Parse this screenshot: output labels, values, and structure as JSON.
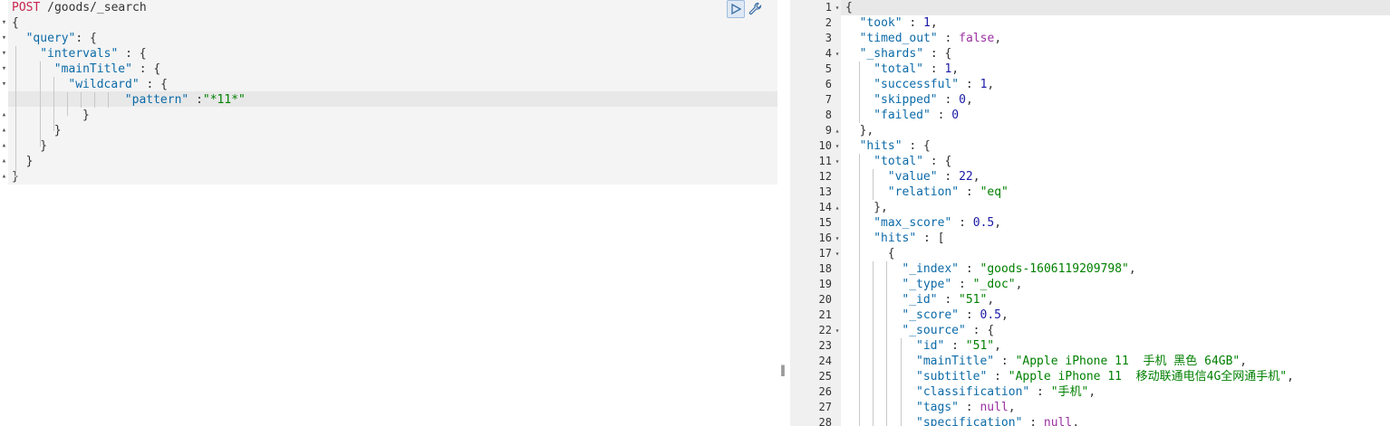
{
  "request": {
    "method": "POST",
    "path": "/goods/_search",
    "lines": [
      [
        {
          "t": "{",
          "c": "p"
        }
      ],
      [
        {
          "t": "\"query\"",
          "c": "k"
        },
        {
          "t": ": {",
          "c": "p"
        }
      ],
      [
        {
          "t": "\"intervals\"",
          "c": "k"
        },
        {
          "t": " : {",
          "c": "p"
        }
      ],
      [
        {
          "t": "\"mainTitle\"",
          "c": "k"
        },
        {
          "t": " : {",
          "c": "p"
        }
      ],
      [
        {
          "t": "\"wildcard\"",
          "c": "k"
        },
        {
          "t": " : {",
          "c": "p"
        }
      ],
      [
        {
          "t": "\"pattern\"",
          "c": "k"
        },
        {
          "t": " :",
          "c": "p"
        },
        {
          "t": "\"*11*\"",
          "c": "s"
        }
      ],
      [
        {
          "t": "}",
          "c": "p"
        }
      ],
      [
        {
          "t": "}",
          "c": "p"
        }
      ],
      [
        {
          "t": "}",
          "c": "p"
        }
      ],
      [
        {
          "t": "}",
          "c": "p"
        }
      ],
      [
        {
          "t": "}",
          "c": "p"
        }
      ]
    ]
  },
  "toolbar": {
    "run_icon": "play-icon",
    "settings_icon": "wrench-icon"
  },
  "response": {
    "line_numbers": [
      "1",
      "2",
      "3",
      "4",
      "5",
      "6",
      "7",
      "8",
      "9",
      "10",
      "11",
      "12",
      "13",
      "14",
      "15",
      "16",
      "17",
      "18",
      "19",
      "20",
      "21",
      "22",
      "23",
      "24",
      "25",
      "26",
      "27",
      "28"
    ],
    "lines": [
      [
        {
          "t": "{",
          "c": "p"
        }
      ],
      [
        {
          "t": "\"took\"",
          "c": "k"
        },
        {
          "t": " : ",
          "c": "p"
        },
        {
          "t": "1",
          "c": "n"
        },
        {
          "t": ",",
          "c": "p"
        }
      ],
      [
        {
          "t": "\"timed_out\"",
          "c": "k"
        },
        {
          "t": " : ",
          "c": "p"
        },
        {
          "t": "false",
          "c": "b"
        },
        {
          "t": ",",
          "c": "p"
        }
      ],
      [
        {
          "t": "\"_shards\"",
          "c": "k"
        },
        {
          "t": " : {",
          "c": "p"
        }
      ],
      [
        {
          "t": "\"total\"",
          "c": "k"
        },
        {
          "t": " : ",
          "c": "p"
        },
        {
          "t": "1",
          "c": "n"
        },
        {
          "t": ",",
          "c": "p"
        }
      ],
      [
        {
          "t": "\"successful\"",
          "c": "k"
        },
        {
          "t": " : ",
          "c": "p"
        },
        {
          "t": "1",
          "c": "n"
        },
        {
          "t": ",",
          "c": "p"
        }
      ],
      [
        {
          "t": "\"skipped\"",
          "c": "k"
        },
        {
          "t": " : ",
          "c": "p"
        },
        {
          "t": "0",
          "c": "n"
        },
        {
          "t": ",",
          "c": "p"
        }
      ],
      [
        {
          "t": "\"failed\"",
          "c": "k"
        },
        {
          "t": " : ",
          "c": "p"
        },
        {
          "t": "0",
          "c": "n"
        }
      ],
      [
        {
          "t": "},",
          "c": "p"
        }
      ],
      [
        {
          "t": "\"hits\"",
          "c": "k"
        },
        {
          "t": " : {",
          "c": "p"
        }
      ],
      [
        {
          "t": "\"total\"",
          "c": "k"
        },
        {
          "t": " : {",
          "c": "p"
        }
      ],
      [
        {
          "t": "\"value\"",
          "c": "k"
        },
        {
          "t": " : ",
          "c": "p"
        },
        {
          "t": "22",
          "c": "n"
        },
        {
          "t": ",",
          "c": "p"
        }
      ],
      [
        {
          "t": "\"relation\"",
          "c": "k"
        },
        {
          "t": " : ",
          "c": "p"
        },
        {
          "t": "\"eq\"",
          "c": "s"
        }
      ],
      [
        {
          "t": "},",
          "c": "p"
        }
      ],
      [
        {
          "t": "\"max_score\"",
          "c": "k"
        },
        {
          "t": " : ",
          "c": "p"
        },
        {
          "t": "0.5",
          "c": "n"
        },
        {
          "t": ",",
          "c": "p"
        }
      ],
      [
        {
          "t": "\"hits\"",
          "c": "k"
        },
        {
          "t": " : [",
          "c": "p"
        }
      ],
      [
        {
          "t": "{",
          "c": "p"
        }
      ],
      [
        {
          "t": "\"_index\"",
          "c": "k"
        },
        {
          "t": " : ",
          "c": "p"
        },
        {
          "t": "\"goods-1606119209798\"",
          "c": "s"
        },
        {
          "t": ",",
          "c": "p"
        }
      ],
      [
        {
          "t": "\"_type\"",
          "c": "k"
        },
        {
          "t": " : ",
          "c": "p"
        },
        {
          "t": "\"_doc\"",
          "c": "s"
        },
        {
          "t": ",",
          "c": "p"
        }
      ],
      [
        {
          "t": "\"_id\"",
          "c": "k"
        },
        {
          "t": " : ",
          "c": "p"
        },
        {
          "t": "\"51\"",
          "c": "s"
        },
        {
          "t": ",",
          "c": "p"
        }
      ],
      [
        {
          "t": "\"_score\"",
          "c": "k"
        },
        {
          "t": " : ",
          "c": "p"
        },
        {
          "t": "0.5",
          "c": "n"
        },
        {
          "t": ",",
          "c": "p"
        }
      ],
      [
        {
          "t": "\"_source\"",
          "c": "k"
        },
        {
          "t": " : {",
          "c": "p"
        }
      ],
      [
        {
          "t": "\"id\"",
          "c": "k"
        },
        {
          "t": " : ",
          "c": "p"
        },
        {
          "t": "\"51\"",
          "c": "s"
        },
        {
          "t": ",",
          "c": "p"
        }
      ],
      [
        {
          "t": "\"mainTitle\"",
          "c": "k"
        },
        {
          "t": " : ",
          "c": "p"
        },
        {
          "t": "\"Apple iPhone 11  手机 黑色 64GB\"",
          "c": "s"
        },
        {
          "t": ",",
          "c": "p"
        }
      ],
      [
        {
          "t": "\"subtitle\"",
          "c": "k"
        },
        {
          "t": " : ",
          "c": "p"
        },
        {
          "t": "\"Apple iPhone 11  移动联通电信4G全网通手机\"",
          "c": "s"
        },
        {
          "t": ",",
          "c": "p"
        }
      ],
      [
        {
          "t": "\"classification\"",
          "c": "k"
        },
        {
          "t": " : ",
          "c": "p"
        },
        {
          "t": "\"手机\"",
          "c": "s"
        },
        {
          "t": ",",
          "c": "p"
        }
      ],
      [
        {
          "t": "\"tags\"",
          "c": "k"
        },
        {
          "t": " : ",
          "c": "p"
        },
        {
          "t": "null",
          "c": "b"
        },
        {
          "t": ",",
          "c": "p"
        }
      ],
      [
        {
          "t": "\"specification\"",
          "c": "k"
        },
        {
          "t": " : ",
          "c": "p"
        },
        {
          "t": "null",
          "c": "b"
        },
        {
          "t": ",",
          "c": "p"
        }
      ]
    ]
  },
  "colors": {
    "key": "#0b6aa8",
    "string": "#008000",
    "method": "#c7254e",
    "active_line": "#e8e8e8",
    "editor_bg": "#f4f4f4"
  }
}
